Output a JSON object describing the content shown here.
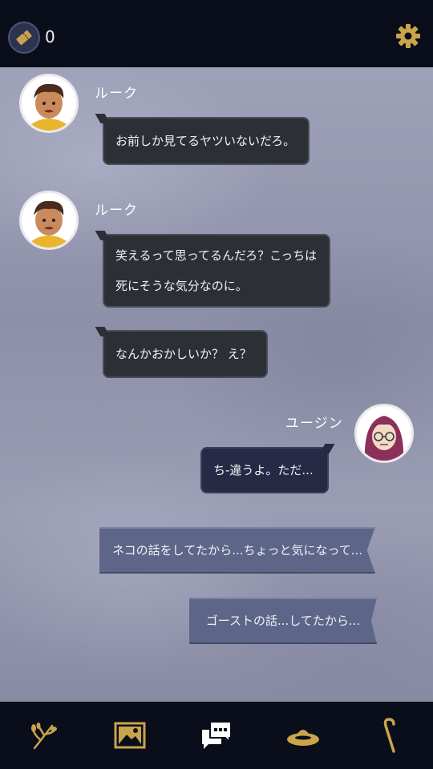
{
  "header": {
    "ticket_count": "0"
  },
  "messages": [
    {
      "speaker": "ルーク",
      "lines": [
        "お前しか見てるヤツいないだろ。"
      ]
    },
    {
      "speaker": "ルーク",
      "lines": [
        "笑えるって思ってるんだろ？こっちは",
        "死にそうな気分なのに。"
      ]
    },
    {
      "lines": [
        "なんかおかしいか？ え？"
      ]
    },
    {
      "speaker": "ユージン",
      "lines": [
        "ち-違うよ。ただ..."
      ]
    }
  ],
  "choices": [
    "ネコの話をしてたから...ちょっと気になって...",
    "ゴーストの話...してたから..."
  ],
  "bottom_nav": [
    {
      "icon": "herb-icon"
    },
    {
      "icon": "picture-icon"
    },
    {
      "icon": "chat-icon"
    },
    {
      "icon": "hat-icon"
    },
    {
      "icon": "cane-icon"
    }
  ],
  "colors": {
    "accent_gold": "#c9a44a",
    "background": "#0a0e1a"
  }
}
